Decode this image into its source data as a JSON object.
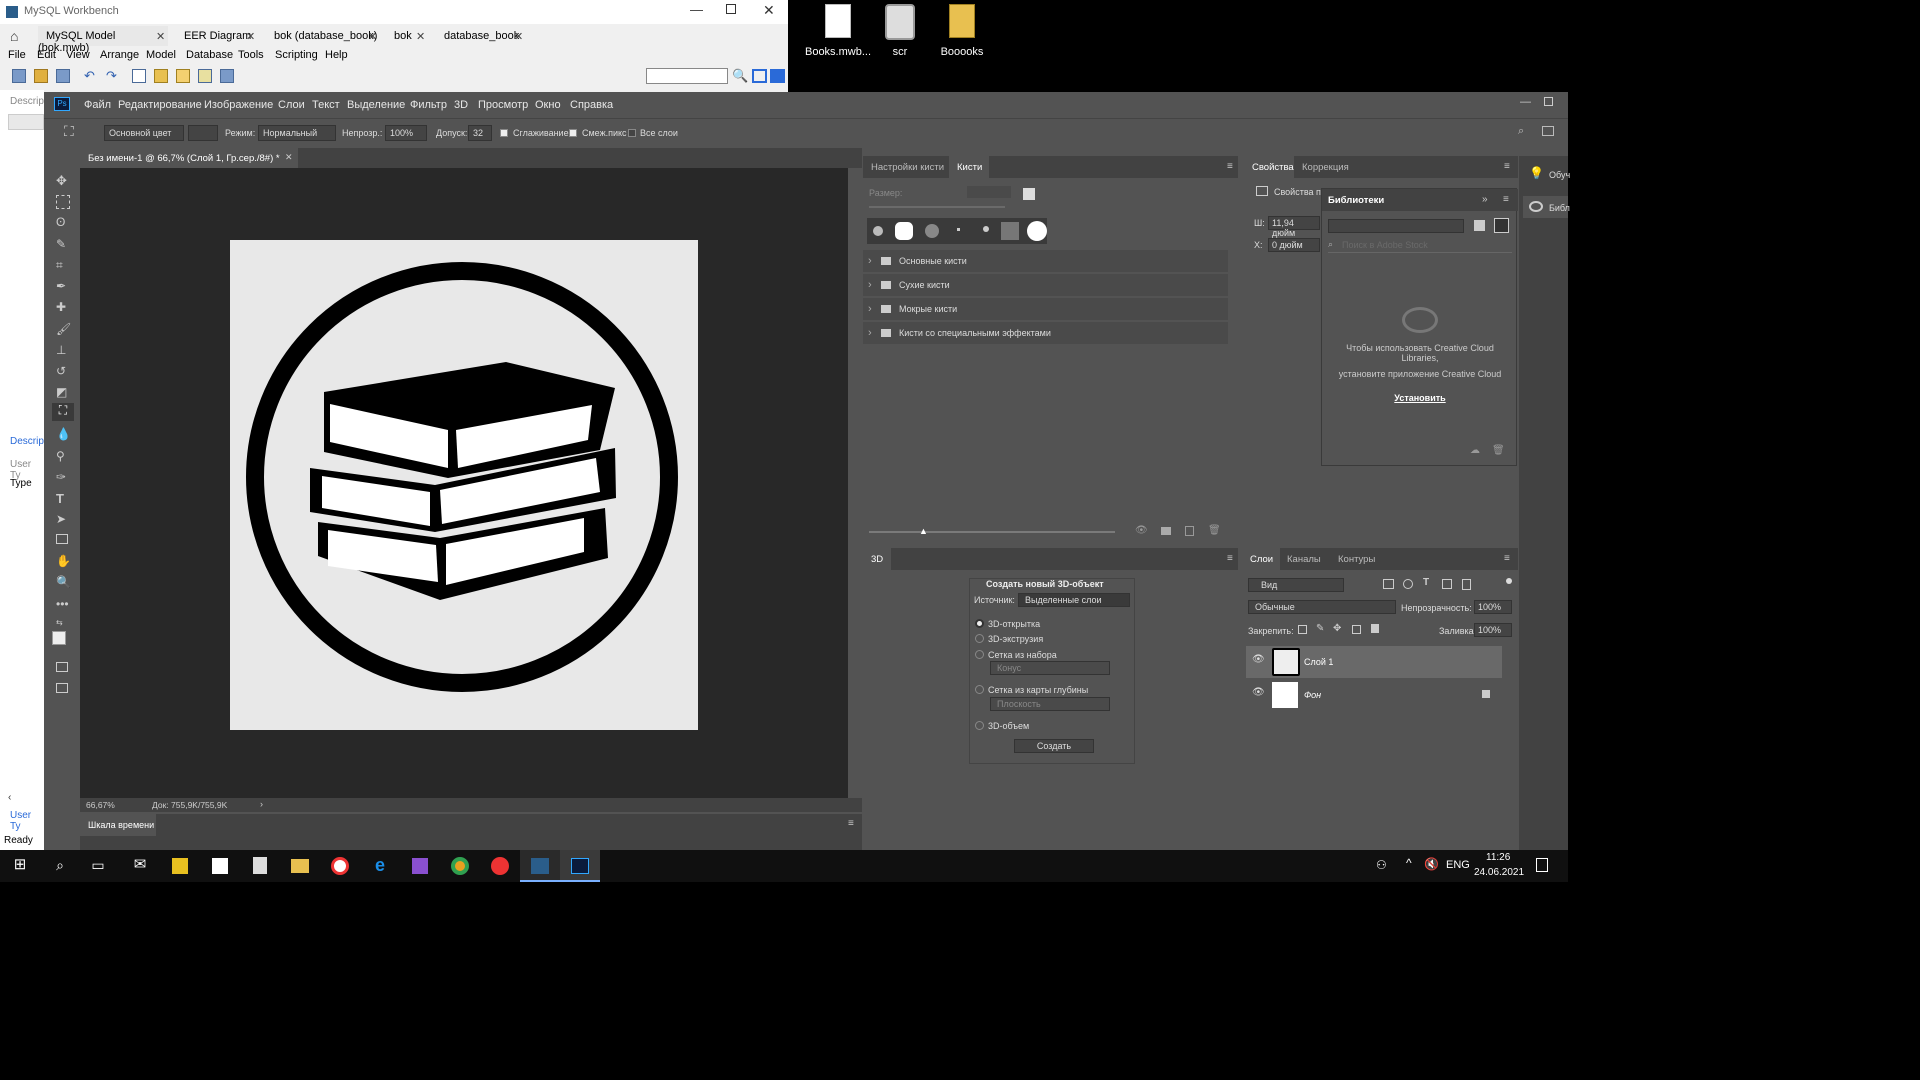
{
  "workbench": {
    "title": "MySQL Workbench",
    "tabs": [
      {
        "label": "MySQL Model (bok.mwb)"
      },
      {
        "label": "EER Diagram"
      },
      {
        "label": "bok (database_book)"
      },
      {
        "label": "bok"
      },
      {
        "label": "database_book"
      }
    ],
    "menu": [
      "File",
      "Edit",
      "View",
      "Arrange",
      "Model",
      "Database",
      "Tools",
      "Scripting",
      "Help"
    ],
    "side_labels": {
      "descrip_top": "Descrip",
      "descrip_mid": "Descrip",
      "user_ty": "User Ty",
      "type": "Type",
      "user_ty_bottom": "User Ty",
      "ready": "Ready"
    }
  },
  "desktop": {
    "icons": [
      {
        "label": "Books.mwb..."
      },
      {
        "label": "scr"
      },
      {
        "label": "Booooks"
      }
    ]
  },
  "photoshop": {
    "logo": "Ps",
    "menu": [
      "Файл",
      "Редактирование",
      "Изображение",
      "Слои",
      "Текст",
      "Выделение",
      "Фильтр",
      "3D",
      "Просмотр",
      "Окно",
      "Справка"
    ],
    "options": {
      "source": "Основной цвет",
      "mode_label": "Режим:",
      "mode": "Нормальный",
      "opacity_label": "Непрозр.:",
      "opacity": "100%",
      "tolerance_label": "Допуск:",
      "tolerance": "32",
      "antialias": "Сглаживание",
      "contiguous": "Смеж.пикс",
      "all_layers": "Все слои"
    },
    "document_tab": "Без имени-1 @ 66,7% (Слой 1, Гр.сер./8#) *",
    "status": {
      "zoom": "66,67%",
      "doc": "Док: 755,9K/755,9K"
    },
    "timeline": "Шкала времени",
    "brush_panel": {
      "tabs": [
        "Настройки кисти",
        "Кисти"
      ],
      "size_label": "Размер:",
      "groups": [
        "Основные кисти",
        "Сухие кисти",
        "Мокрые кисти",
        "Кисти со специальными эффектами"
      ]
    },
    "threed_panel": {
      "tab": "3D",
      "title": "Создать новый 3D-объект",
      "source_label": "Источник:",
      "source": "Выделенные слои",
      "options": [
        "3D-открытка",
        "3D-экструзия",
        "Сетка из набора",
        "Сетка из карты глубины",
        "3D-объем"
      ],
      "preset": "Конус",
      "depth": "Плоскость",
      "create": "Создать"
    },
    "properties_panel": {
      "tabs": [
        "Свойства",
        "Коррекция"
      ],
      "heading": "Свойства п",
      "w_label": "Ш:",
      "w_value": "11,94 дюйм",
      "x_label": "X:",
      "x_value": "0 дюйм"
    },
    "libraries_panel": {
      "title": "Библиотеки",
      "search_placeholder": "Поиск в Adobe Stock",
      "message_1": "Чтобы использовать Creative Cloud Libraries,",
      "message_2": "установите приложение Creative Cloud",
      "install": "Установить"
    },
    "layers_panel": {
      "tabs": [
        "Слои",
        "Каналы",
        "Контуры"
      ],
      "filter": "Вид",
      "blend": "Обычные",
      "opacity_label": "Непрозрачность:",
      "opacity": "100%",
      "lock_label": "Закрепить:",
      "fill_label": "Заливка:",
      "fill": "100%",
      "layers": [
        {
          "name": "Слой 1"
        },
        {
          "name": "Фон"
        }
      ]
    },
    "right_strip": {
      "learn": "Обуч",
      "libraries": "Библ"
    }
  },
  "taskbar": {
    "lang": "ENG",
    "time": "11:26",
    "date": "24.06.2021"
  }
}
